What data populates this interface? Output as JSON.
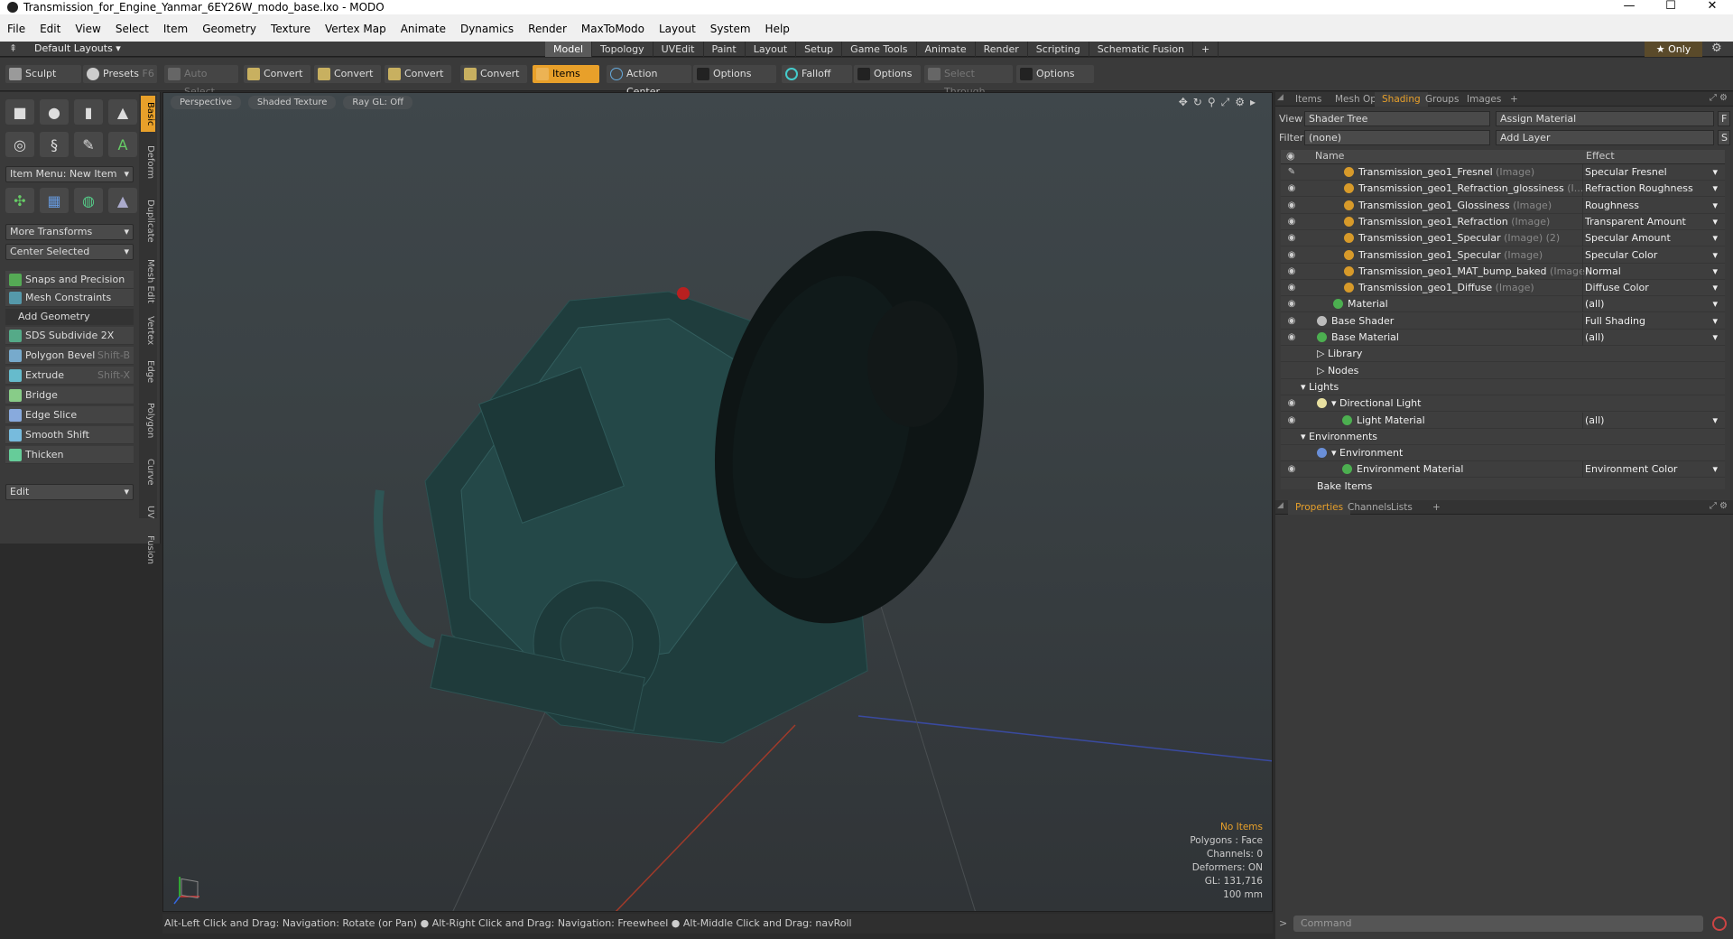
{
  "window": {
    "title": "Transmission_for_Engine_Yanmar_6EY26W_modo_base.lxo - MODO",
    "controls": [
      "—",
      "☐",
      "✕"
    ]
  },
  "menu": [
    "File",
    "Edit",
    "View",
    "Select",
    "Item",
    "Geometry",
    "Texture",
    "Vertex Map",
    "Animate",
    "Dynamics",
    "Render",
    "MaxToModo",
    "Layout",
    "System",
    "Help"
  ],
  "layoutbar": {
    "default_layouts": "Default Layouts ▾",
    "tabs": [
      "Model",
      "Topology",
      "UVEdit",
      "Paint",
      "Layout",
      "Setup",
      "Game Tools",
      "Animate",
      "Render",
      "Scripting",
      "Schematic Fusion",
      "+"
    ],
    "active_tab": "Model",
    "only": "★ Only"
  },
  "toolbar": {
    "sculpt": "Sculpt",
    "presets": "Presets",
    "presets_key": "F6",
    "auto_select": "Auto Select",
    "convert1": "Convert",
    "convert2": "Convert",
    "convert3": "Convert",
    "convert4": "Convert",
    "items": "Items",
    "action_center": "Action Center",
    "options1": "Options",
    "falloff": "Falloff",
    "options2": "Options",
    "select_through": "Select Through",
    "options3": "Options"
  },
  "left": {
    "vtabs": [
      "Basic",
      "Deform",
      "Duplicate",
      "Mesh Edit",
      "Vertex",
      "Edge",
      "Polygon",
      "Curve",
      "UV",
      "Fusion"
    ],
    "item_menu": "Item Menu: New Item",
    "more_transforms": "More Transforms",
    "center_selected": "Center Selected",
    "snaps": "Snaps and Precision",
    "constraints": "Mesh Constraints",
    "add_geometry": "Add Geometry",
    "tools": [
      {
        "label": "SDS Subdivide 2X",
        "key": ""
      },
      {
        "label": "Polygon Bevel",
        "key": "Shift-B"
      },
      {
        "label": "Extrude",
        "key": "Shift-X"
      },
      {
        "label": "Bridge",
        "key": ""
      },
      {
        "label": "Edge Slice",
        "key": ""
      },
      {
        "label": "Smooth Shift",
        "key": ""
      },
      {
        "label": "Thicken",
        "key": ""
      }
    ],
    "edit": "Edit"
  },
  "viewport": {
    "perspective": "Perspective",
    "shading": "Shaded Texture",
    "raygl": "Ray GL: Off",
    "info": {
      "items": "No Items",
      "polygons": "Polygons : Face",
      "channels": "Channels: 0",
      "deformers": "Deformers: ON",
      "gl": "GL: 131,716",
      "scale": "100 mm"
    }
  },
  "status": "Alt-Left Click and Drag: Navigation: Rotate (or Pan) ● Alt-Right Click and Drag: Navigation: Freewheel ● Alt-Middle Click and Drag: navRoll",
  "right": {
    "tabs": [
      "Items",
      "Mesh Ops",
      "Shading",
      "Groups",
      "Images",
      "+"
    ],
    "active_tab": "Shading",
    "view_label": "View",
    "view_value": "Shader Tree",
    "assign_material": "Assign Material",
    "f_btn": "F",
    "filter_label": "Filter",
    "filter_value": "(none)",
    "add_layer": "Add Layer",
    "s_btn": "S",
    "col_name": "Name",
    "col_effect": "Effect",
    "rows": [
      {
        "eye": "✎",
        "name": "Transmission_geo1_Fresnel",
        "sub": "(Image)",
        "effect": "Specular Fresnel",
        "ind": 70,
        "dot": "#d79a2a"
      },
      {
        "eye": "◉",
        "name": "Transmission_geo1_Refraction_glossiness",
        "sub": "(I...",
        "effect": "Refraction Roughness",
        "ind": 70,
        "dot": "#d79a2a"
      },
      {
        "eye": "◉",
        "name": "Transmission_geo1_Glossiness",
        "sub": "(Image)",
        "effect": "Roughness",
        "ind": 70,
        "dot": "#d79a2a"
      },
      {
        "eye": "◉",
        "name": "Transmission_geo1_Refraction",
        "sub": "(Image)",
        "effect": "Transparent Amount",
        "ind": 70,
        "dot": "#d79a2a"
      },
      {
        "eye": "◉",
        "name": "Transmission_geo1_Specular",
        "sub": "(Image) (2)",
        "effect": "Specular Amount",
        "ind": 70,
        "dot": "#d79a2a"
      },
      {
        "eye": "◉",
        "name": "Transmission_geo1_Specular",
        "sub": "(Image)",
        "effect": "Specular Color",
        "ind": 70,
        "dot": "#d79a2a"
      },
      {
        "eye": "◉",
        "name": "Transmission_geo1_MAT_bump_baked",
        "sub": "(Image)",
        "effect": "Normal",
        "ind": 70,
        "dot": "#d79a2a"
      },
      {
        "eye": "◉",
        "name": "Transmission_geo1_Diffuse",
        "sub": "(Image)",
        "effect": "Diffuse Color",
        "ind": 70,
        "dot": "#d79a2a"
      },
      {
        "eye": "◉",
        "name": "Material",
        "sub": "",
        "effect": "(all)",
        "ind": 58,
        "dot": "#4caf50"
      },
      {
        "eye": "◉",
        "name": "Base Shader",
        "sub": "",
        "effect": "Full Shading",
        "ind": 40,
        "dot": "#bbbbbb"
      },
      {
        "eye": "◉",
        "name": "Base Material",
        "sub": "",
        "effect": "(all)",
        "ind": 40,
        "dot": "#4caf50"
      },
      {
        "eye": "",
        "name": "▷ Library",
        "sub": "",
        "effect": "",
        "ind": 40,
        "dot": ""
      },
      {
        "eye": "",
        "name": "▷ Nodes",
        "sub": "",
        "effect": "",
        "ind": 40,
        "dot": ""
      },
      {
        "eye": "",
        "name": "▾ Lights",
        "sub": "",
        "effect": "",
        "ind": 22,
        "dot": ""
      },
      {
        "eye": "◉",
        "name": "▾ Directional Light",
        "sub": "",
        "effect": "",
        "ind": 40,
        "dot": "#e8e0a0"
      },
      {
        "eye": "◉",
        "name": "Light Material",
        "sub": "",
        "effect": "(all)",
        "ind": 68,
        "dot": "#4caf50"
      },
      {
        "eye": "",
        "name": "▾ Environments",
        "sub": "",
        "effect": "",
        "ind": 22,
        "dot": ""
      },
      {
        "eye": "",
        "name": "▾ Environment",
        "sub": "",
        "effect": "",
        "ind": 40,
        "dot": "#6a8fd8"
      },
      {
        "eye": "◉",
        "name": "Environment Material",
        "sub": "",
        "effect": "Environment Color",
        "ind": 68,
        "dot": "#4caf50"
      },
      {
        "eye": "",
        "name": "Bake Items",
        "sub": "",
        "effect": "",
        "ind": 40,
        "dot": ""
      }
    ],
    "prop_tabs": [
      "Properties",
      "Channels",
      "Lists",
      "+"
    ],
    "prop_active": "Properties",
    "command_placeholder": "Command"
  }
}
